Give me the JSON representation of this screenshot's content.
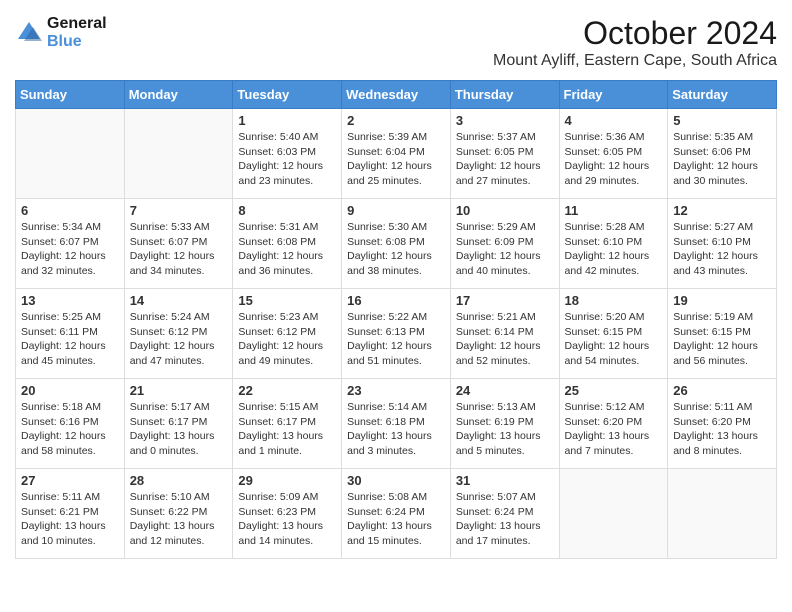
{
  "logo": {
    "line1": "General",
    "line2": "Blue"
  },
  "title": "October 2024",
  "subtitle": "Mount Ayliff, Eastern Cape, South Africa",
  "days_header": [
    "Sunday",
    "Monday",
    "Tuesday",
    "Wednesday",
    "Thursday",
    "Friday",
    "Saturday"
  ],
  "weeks": [
    [
      {
        "day": "",
        "sunrise": "",
        "sunset": "",
        "daylight": ""
      },
      {
        "day": "",
        "sunrise": "",
        "sunset": "",
        "daylight": ""
      },
      {
        "day": "1",
        "sunrise": "Sunrise: 5:40 AM",
        "sunset": "Sunset: 6:03 PM",
        "daylight": "Daylight: 12 hours and 23 minutes."
      },
      {
        "day": "2",
        "sunrise": "Sunrise: 5:39 AM",
        "sunset": "Sunset: 6:04 PM",
        "daylight": "Daylight: 12 hours and 25 minutes."
      },
      {
        "day": "3",
        "sunrise": "Sunrise: 5:37 AM",
        "sunset": "Sunset: 6:05 PM",
        "daylight": "Daylight: 12 hours and 27 minutes."
      },
      {
        "day": "4",
        "sunrise": "Sunrise: 5:36 AM",
        "sunset": "Sunset: 6:05 PM",
        "daylight": "Daylight: 12 hours and 29 minutes."
      },
      {
        "day": "5",
        "sunrise": "Sunrise: 5:35 AM",
        "sunset": "Sunset: 6:06 PM",
        "daylight": "Daylight: 12 hours and 30 minutes."
      }
    ],
    [
      {
        "day": "6",
        "sunrise": "Sunrise: 5:34 AM",
        "sunset": "Sunset: 6:07 PM",
        "daylight": "Daylight: 12 hours and 32 minutes."
      },
      {
        "day": "7",
        "sunrise": "Sunrise: 5:33 AM",
        "sunset": "Sunset: 6:07 PM",
        "daylight": "Daylight: 12 hours and 34 minutes."
      },
      {
        "day": "8",
        "sunrise": "Sunrise: 5:31 AM",
        "sunset": "Sunset: 6:08 PM",
        "daylight": "Daylight: 12 hours and 36 minutes."
      },
      {
        "day": "9",
        "sunrise": "Sunrise: 5:30 AM",
        "sunset": "Sunset: 6:08 PM",
        "daylight": "Daylight: 12 hours and 38 minutes."
      },
      {
        "day": "10",
        "sunrise": "Sunrise: 5:29 AM",
        "sunset": "Sunset: 6:09 PM",
        "daylight": "Daylight: 12 hours and 40 minutes."
      },
      {
        "day": "11",
        "sunrise": "Sunrise: 5:28 AM",
        "sunset": "Sunset: 6:10 PM",
        "daylight": "Daylight: 12 hours and 42 minutes."
      },
      {
        "day": "12",
        "sunrise": "Sunrise: 5:27 AM",
        "sunset": "Sunset: 6:10 PM",
        "daylight": "Daylight: 12 hours and 43 minutes."
      }
    ],
    [
      {
        "day": "13",
        "sunrise": "Sunrise: 5:25 AM",
        "sunset": "Sunset: 6:11 PM",
        "daylight": "Daylight: 12 hours and 45 minutes."
      },
      {
        "day": "14",
        "sunrise": "Sunrise: 5:24 AM",
        "sunset": "Sunset: 6:12 PM",
        "daylight": "Daylight: 12 hours and 47 minutes."
      },
      {
        "day": "15",
        "sunrise": "Sunrise: 5:23 AM",
        "sunset": "Sunset: 6:12 PM",
        "daylight": "Daylight: 12 hours and 49 minutes."
      },
      {
        "day": "16",
        "sunrise": "Sunrise: 5:22 AM",
        "sunset": "Sunset: 6:13 PM",
        "daylight": "Daylight: 12 hours and 51 minutes."
      },
      {
        "day": "17",
        "sunrise": "Sunrise: 5:21 AM",
        "sunset": "Sunset: 6:14 PM",
        "daylight": "Daylight: 12 hours and 52 minutes."
      },
      {
        "day": "18",
        "sunrise": "Sunrise: 5:20 AM",
        "sunset": "Sunset: 6:15 PM",
        "daylight": "Daylight: 12 hours and 54 minutes."
      },
      {
        "day": "19",
        "sunrise": "Sunrise: 5:19 AM",
        "sunset": "Sunset: 6:15 PM",
        "daylight": "Daylight: 12 hours and 56 minutes."
      }
    ],
    [
      {
        "day": "20",
        "sunrise": "Sunrise: 5:18 AM",
        "sunset": "Sunset: 6:16 PM",
        "daylight": "Daylight: 12 hours and 58 minutes."
      },
      {
        "day": "21",
        "sunrise": "Sunrise: 5:17 AM",
        "sunset": "Sunset: 6:17 PM",
        "daylight": "Daylight: 13 hours and 0 minutes."
      },
      {
        "day": "22",
        "sunrise": "Sunrise: 5:15 AM",
        "sunset": "Sunset: 6:17 PM",
        "daylight": "Daylight: 13 hours and 1 minute."
      },
      {
        "day": "23",
        "sunrise": "Sunrise: 5:14 AM",
        "sunset": "Sunset: 6:18 PM",
        "daylight": "Daylight: 13 hours and 3 minutes."
      },
      {
        "day": "24",
        "sunrise": "Sunrise: 5:13 AM",
        "sunset": "Sunset: 6:19 PM",
        "daylight": "Daylight: 13 hours and 5 minutes."
      },
      {
        "day": "25",
        "sunrise": "Sunrise: 5:12 AM",
        "sunset": "Sunset: 6:20 PM",
        "daylight": "Daylight: 13 hours and 7 minutes."
      },
      {
        "day": "26",
        "sunrise": "Sunrise: 5:11 AM",
        "sunset": "Sunset: 6:20 PM",
        "daylight": "Daylight: 13 hours and 8 minutes."
      }
    ],
    [
      {
        "day": "27",
        "sunrise": "Sunrise: 5:11 AM",
        "sunset": "Sunset: 6:21 PM",
        "daylight": "Daylight: 13 hours and 10 minutes."
      },
      {
        "day": "28",
        "sunrise": "Sunrise: 5:10 AM",
        "sunset": "Sunset: 6:22 PM",
        "daylight": "Daylight: 13 hours and 12 minutes."
      },
      {
        "day": "29",
        "sunrise": "Sunrise: 5:09 AM",
        "sunset": "Sunset: 6:23 PM",
        "daylight": "Daylight: 13 hours and 14 minutes."
      },
      {
        "day": "30",
        "sunrise": "Sunrise: 5:08 AM",
        "sunset": "Sunset: 6:24 PM",
        "daylight": "Daylight: 13 hours and 15 minutes."
      },
      {
        "day": "31",
        "sunrise": "Sunrise: 5:07 AM",
        "sunset": "Sunset: 6:24 PM",
        "daylight": "Daylight: 13 hours and 17 minutes."
      },
      {
        "day": "",
        "sunrise": "",
        "sunset": "",
        "daylight": ""
      },
      {
        "day": "",
        "sunrise": "",
        "sunset": "",
        "daylight": ""
      }
    ]
  ]
}
